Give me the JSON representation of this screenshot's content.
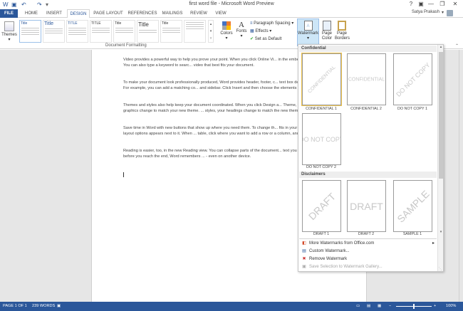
{
  "window": {
    "title": "first word file - Microsoft Word Preview",
    "help": "?",
    "minimize": "—",
    "restore": "❐",
    "close": "✕"
  },
  "tabs": [
    "FILE",
    "HOME",
    "INSERT",
    "DESIGN",
    "PAGE LAYOUT",
    "REFERENCES",
    "MAILINGS",
    "REVIEW",
    "VIEW"
  ],
  "user": {
    "name": "Satya Prakash"
  },
  "ribbon": {
    "themes_label": "Themes",
    "gallery": [
      "Title",
      "Title",
      "TITLE",
      "TITLE",
      "Title",
      "Title",
      "Title"
    ],
    "group_label": "Document Formatting",
    "colors_label": "Colors",
    "fonts_label": "Fonts",
    "paragraph_spacing": "Paragraph Spacing",
    "effects": "Effects",
    "set_default": "Set as Default",
    "watermark": "Watermark",
    "page_color": "Page Color",
    "page_borders": "Page Borders"
  },
  "document": {
    "paragraphs": [
      "Video provides a powerful way to help you prove your point. When you click Online Vi... in the embed code for the video you want to add. You can also type a keyword to searc... video that best fits your document.",
      "To make your document look professionally produced, Word provides header, footer, c... text box designs that complement each other. For example, you can add a matching co... and sidebar. Click Insert and then choose the elements you want from the different gal...",
      "Themes and styles also help keep your document coordinated. When you click Design a... Theme, the pictures, charts, and SmartArt graphics change to match your new theme. ... styles, your headings change to match the new theme.",
      "Save time in Word with new buttons that show up where you need them. To change th... fits in your document, click it and a button for layout options appears next to it. When ... table, click where you want to add a row or a column, and then click the plus sign.",
      "Reading is easier, too, in the new Reading view. You can collapse parts of the document... text you want. If you need to stop reading before you reach the end, Word remembers ... - even on another device."
    ]
  },
  "watermark_menu": {
    "section1": "Confidential",
    "section2": "Disclaimers",
    "confidential_items": [
      {
        "label": "CONFIDENTIAL 1",
        "text": "CONFIDENTIAL"
      },
      {
        "label": "CONFIDENTIAL 2",
        "text": "CONFIDENTIAL"
      },
      {
        "label": "DO NOT COPY 1",
        "text": "DO NOT COPY"
      },
      {
        "label": "DO NOT COPY 2",
        "text": "DO NOT COPY"
      }
    ],
    "disclaimer_items": [
      {
        "label": "DRAFT 1",
        "text": "DRAFT"
      },
      {
        "label": "DRAFT 2",
        "text": "DRAFT"
      },
      {
        "label": "SAMPLE 1",
        "text": "SAMPLE"
      }
    ],
    "actions": [
      {
        "label": "More Watermarks from Office.com",
        "icon": "office-icon"
      },
      {
        "label": "Custom Watermark...",
        "icon": "custom-watermark-icon"
      },
      {
        "label": "Remove Watermark",
        "icon": "remove-watermark-icon"
      },
      {
        "label": "Save Selection to Watermark Gallery...",
        "icon": "save-gallery-icon",
        "disabled": true
      }
    ]
  },
  "status": {
    "page": "PAGE 1 OF 1",
    "words": "239 WORDS",
    "zoom": "100%"
  }
}
